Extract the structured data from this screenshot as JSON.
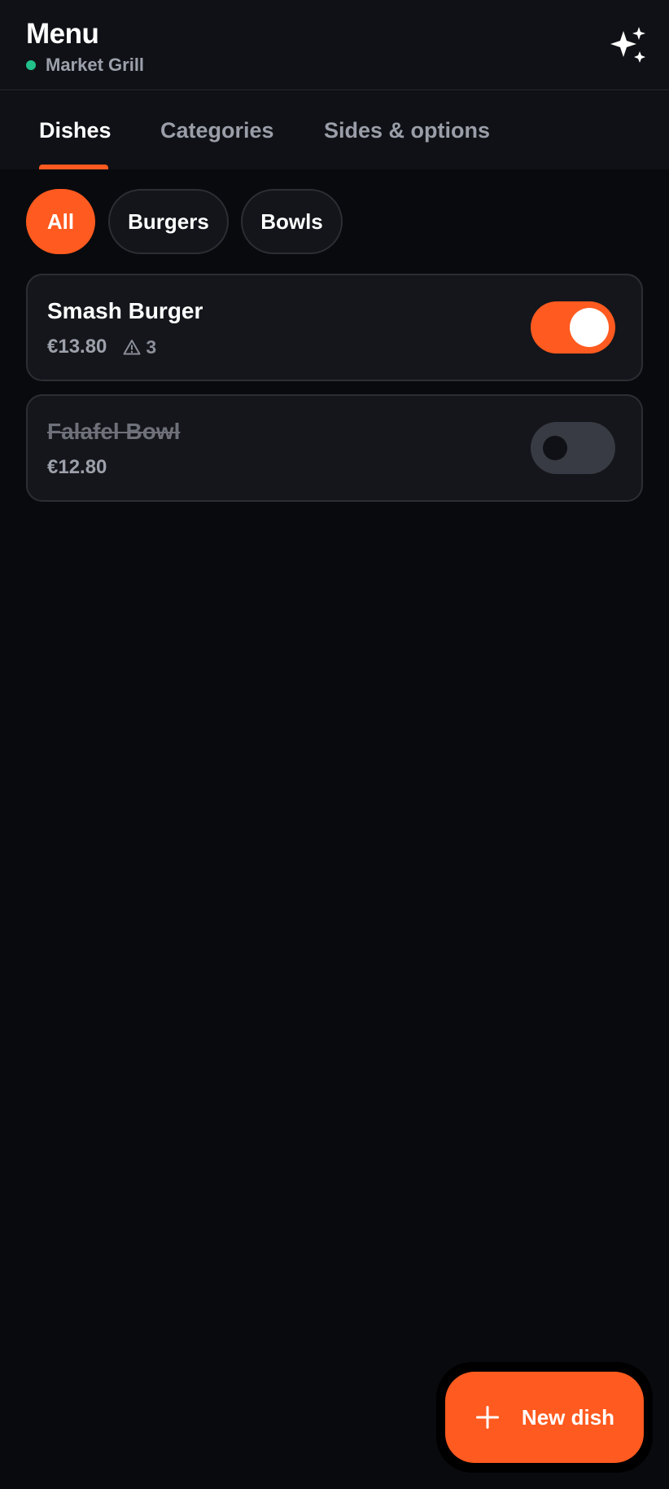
{
  "header": {
    "title": "Menu",
    "venue_name": "Market Grill",
    "venue_status_color": "#22c08a",
    "action_icon": "sparkles-icon"
  },
  "tabs": [
    {
      "label": "Dishes",
      "active": true
    },
    {
      "label": "Categories",
      "active": false
    },
    {
      "label": "Sides & options",
      "active": false
    }
  ],
  "filters": [
    {
      "label": "All",
      "active": true
    },
    {
      "label": "Burgers",
      "active": false
    },
    {
      "label": "Bowls",
      "active": false
    }
  ],
  "dishes": [
    {
      "name": "Smash Burger",
      "price": "€13.80",
      "warning_icon": "warning-triangle-icon",
      "warning_count": "3",
      "available": true
    },
    {
      "name": "Falafel Bowl",
      "price": "€12.80",
      "available": false
    }
  ],
  "fab": {
    "label": "New dish",
    "icon": "plus-icon"
  },
  "colors": {
    "accent": "#ff5a1f",
    "background": "#090a0e",
    "surface": "#15161b"
  }
}
